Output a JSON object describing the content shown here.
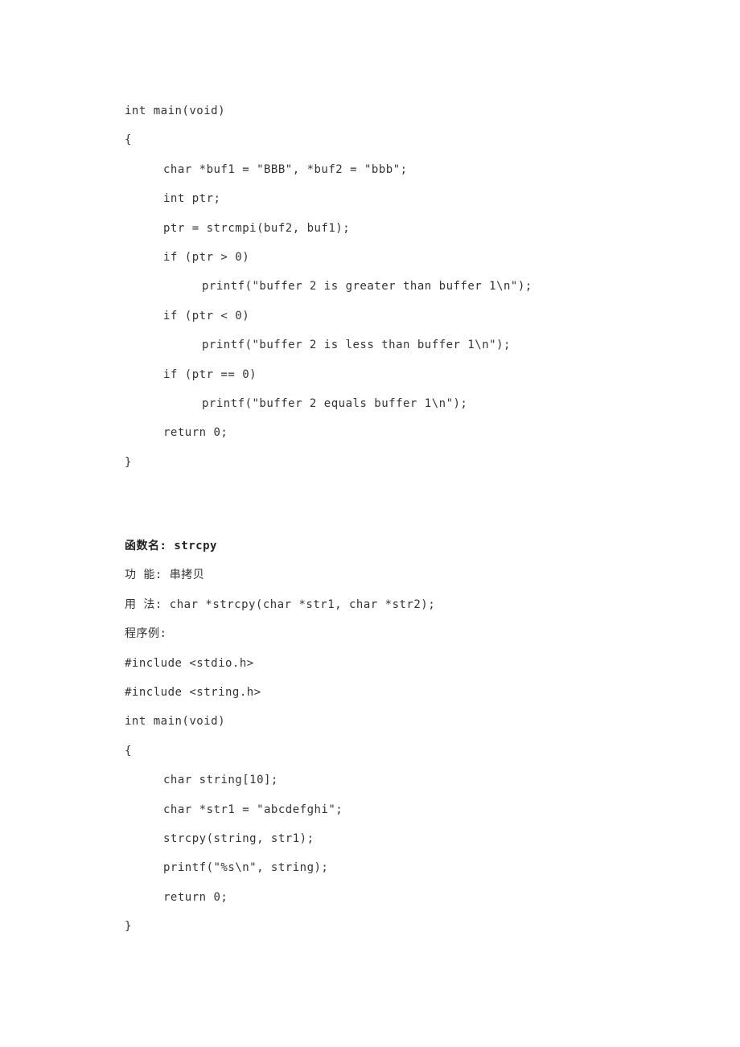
{
  "code1": {
    "l1": "int main(void)",
    "l2": "{",
    "l3": "char *buf1 = \"BBB\", *buf2 = \"bbb\";",
    "l4": "int ptr;",
    "l5": "ptr = strcmpi(buf2, buf1);",
    "l6": "if (ptr > 0)",
    "l7": "printf(\"buffer 2 is greater than buffer 1\\n\");",
    "l8": "if (ptr < 0)",
    "l9": "printf(\"buffer 2 is less than buffer 1\\n\");",
    "l10": "if (ptr == 0)",
    "l11": "printf(\"buffer 2 equals buffer 1\\n\");",
    "l12": "return 0;",
    "l13": "}"
  },
  "section": {
    "title": "函数名: strcpy",
    "func_desc": "功 能: 串拷贝",
    "usage": "用 法: char *strcpy(char *str1, char *str2);",
    "example_label": "程序例:"
  },
  "code2": {
    "l1": "#include <stdio.h>",
    "l2": "#include <string.h>",
    "l3": "int main(void)",
    "l4": "{",
    "l5": "char string[10];",
    "l6": "char *str1 = \"abcdefghi\";",
    "l7": "strcpy(string, str1);",
    "l8": "printf(\"%s\\n\", string);",
    "l9": "return 0;",
    "l10": "}"
  }
}
